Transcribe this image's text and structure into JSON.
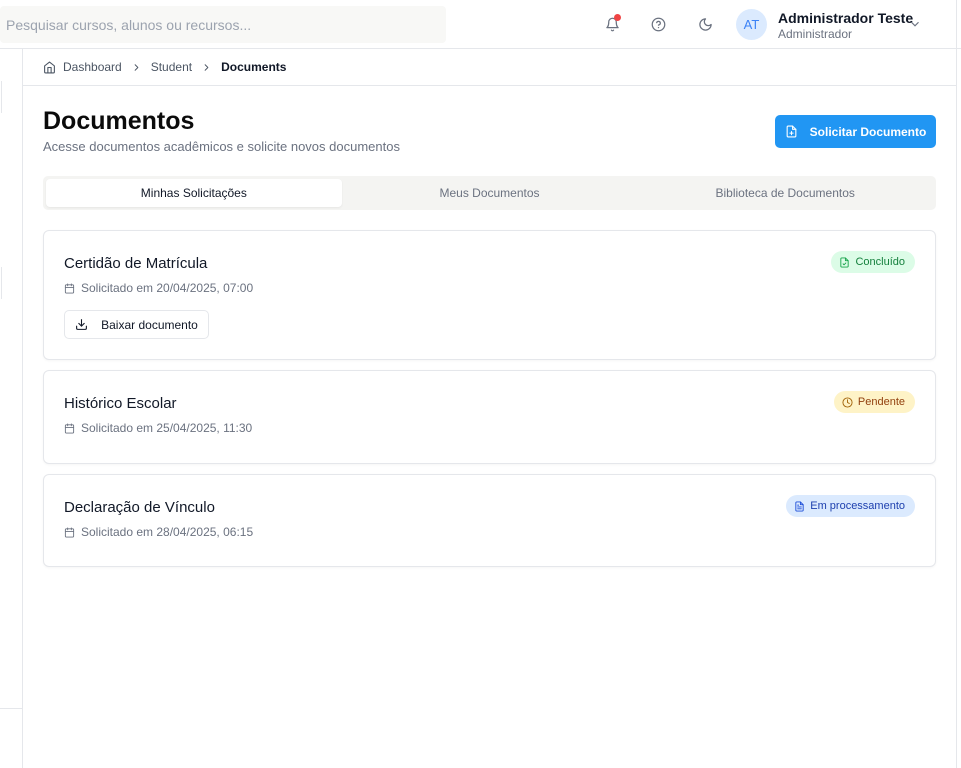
{
  "header": {
    "search_placeholder": "Pesquisar cursos, alunos ou recursos...",
    "user": {
      "initials": "AT",
      "name": "Administrador Teste",
      "role": "Administrador"
    }
  },
  "breadcrumb": {
    "items": [
      "Dashboard",
      "Student",
      "Documents"
    ]
  },
  "page": {
    "title": "Documentos",
    "subtitle": "Acesse documentos acadêmicos e solicite novos documentos",
    "primary_action": "Solicitar Documento"
  },
  "tabs": [
    {
      "label": "Minhas Solicitações",
      "active": true
    },
    {
      "label": "Meus Documentos",
      "active": false
    },
    {
      "label": "Biblioteca de Documentos",
      "active": false
    }
  ],
  "requests": [
    {
      "title": "Certidão de Matrícula",
      "date": "Solicitado em 20/04/2025, 07:00",
      "status": "Concluído",
      "status_color": "#15803d",
      "action": "Baixar documento"
    },
    {
      "title": "Histórico Escolar",
      "date": "Solicitado em 25/04/2025, 11:30",
      "status": "Pendente",
      "status_color": "#92400e"
    },
    {
      "title": "Declaração de Vínculo",
      "date": "Solicitado em 28/04/2025, 06:15",
      "status": "Em processamento",
      "status_color": "#1e40af"
    }
  ],
  "colors": {
    "primary": "#2196f3",
    "notification": "#ef4444"
  }
}
